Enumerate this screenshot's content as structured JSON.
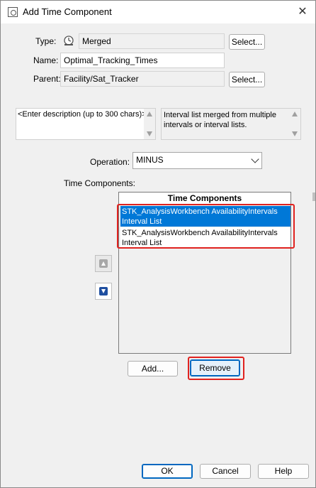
{
  "window": {
    "title": "Add Time Component",
    "close_glyph": "✕"
  },
  "form": {
    "type_label": "Type:",
    "type_value": "Merged",
    "type_icon": "merged-clock-icon",
    "name_label": "Name:",
    "name_value": "Optimal_Tracking_Times",
    "parent_label": "Parent:",
    "parent_value": "Facility/Sat_Tracker",
    "select_label": "Select...",
    "description_placeholder": "<Enter description (up to 300 chars)>",
    "info_text": "Interval list merged from multiple intervals or interval lists.",
    "operation_label": "Operation:",
    "operation_value": "MINUS",
    "time_components_label": "Time Components:"
  },
  "time_components_table": {
    "header": "Time Components",
    "rows": [
      {
        "line1": "STK_AnalysisWorkbench AvailabilityIntervals",
        "line2": "Interval List",
        "selected": true
      },
      {
        "line1": "STK_AnalysisWorkbench AvailabilityIntervals",
        "line2": "Interval List",
        "selected": false
      }
    ]
  },
  "buttons": {
    "add": "Add...",
    "remove": "Remove",
    "ok": "OK",
    "cancel": "Cancel",
    "help": "Help"
  },
  "colors": {
    "selection": "#0078d7",
    "highlight": "#e0221f",
    "focus_border": "#0067c0"
  }
}
